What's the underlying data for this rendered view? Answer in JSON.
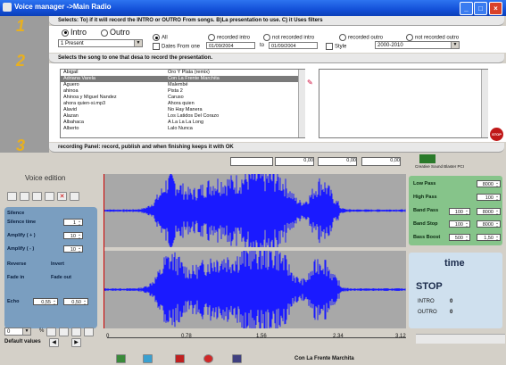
{
  "window": {
    "title": "Voice manager    ->Main Radio"
  },
  "steps": [
    "1",
    "2",
    "3"
  ],
  "step1": {
    "header": "Selects: To) if it will record the INTRO or OUTRO From songs. B)La presentation to use. C) it Uses filters",
    "intro_label": "Intro",
    "outro_label": "Outro",
    "presentation_value": "1 Present",
    "filters": {
      "all": "All",
      "recorded_intro": "recorded intro",
      "not_recorded_intro": "not recorded intro",
      "recorded_outro": "recorded outro",
      "not_recorded_outro": "not recorded outro",
      "dates_from": "Dates From one",
      "date_from": "01/09/2004",
      "to": "to",
      "date_to": "01/09/2004",
      "style": "Style",
      "style_value": "2000-2010"
    }
  },
  "step2": {
    "header": "Selects the song to one that desa to record the presentation.",
    "songs": [
      [
        "Abigail",
        "Oro Y Plata (remix)"
      ],
      [
        "Adriana Varela",
        "Con La Frente Marchita"
      ],
      [
        "Aguero",
        "Malembé"
      ],
      [
        "ahinoa",
        "Pista 2"
      ],
      [
        "Ahinoa y Miguel Nandez",
        "Caruso"
      ],
      [
        "ahora quien-si.mp3",
        "Ahora quien"
      ],
      [
        "Alavid",
        "No Hay Manera"
      ],
      [
        "Alazan",
        "Los Latidos Del Corazo"
      ],
      [
        "Albahaca",
        "A La La La Long"
      ],
      [
        "Alberto",
        "Lalo Nunca"
      ]
    ],
    "selected_index": 1
  },
  "step3": {
    "header": "recording Panel: record, publish and when finishing keeps it with OK"
  },
  "meter": {
    "v1": "0,00",
    "v2": "0,00",
    "v3": "0,00",
    "device": "Creative Sound Blaster PCI"
  },
  "voice": {
    "title": "Voice edition",
    "silence": "Silence",
    "silence_time": "Silence time",
    "silence_time_value": "1",
    "amplify_plus": "Amplify ( + )",
    "amplify_plus_value": "10",
    "amplify_minus": "Amplify ( - )",
    "amplify_minus_value": "10",
    "reverse": "Reverse",
    "invert": "Invert",
    "fade_in": "Fade in",
    "fade_out": "Fade out",
    "echo": "Echo",
    "echo_a": "0,55",
    "echo_b": "0,50",
    "zoom": "0",
    "percent": "%",
    "default_values": "Default values"
  },
  "filters_panel": {
    "low_pass": "Low Pass",
    "low_pass_value": "8000",
    "high_pass": "High Pass",
    "high_pass_value": "100",
    "band_pass": "Band Pass",
    "band_pass_a": "100",
    "band_pass_b": "8000",
    "band_stop": "Band Stop",
    "band_stop_a": "100",
    "band_stop_b": "8000",
    "bass_boost": "Bass Boost",
    "bass_boost_a": "500",
    "bass_boost_b": "1,50"
  },
  "time_panel": {
    "title": "time",
    "state": "STOP",
    "intro": "INTRO",
    "intro_value": "0",
    "outro": "OUTRO",
    "outro_value": "0"
  },
  "ruler": {
    "ticks": [
      "0",
      "0,78",
      "1,56",
      "2,34",
      "3,12"
    ]
  },
  "status": {
    "song": "Con La Frente Marchita"
  },
  "colors": {
    "wave": "#1a1aff",
    "panel_blue": "#7a9ec0",
    "panel_green": "#86c48a",
    "title_blue": "#1350d8"
  }
}
